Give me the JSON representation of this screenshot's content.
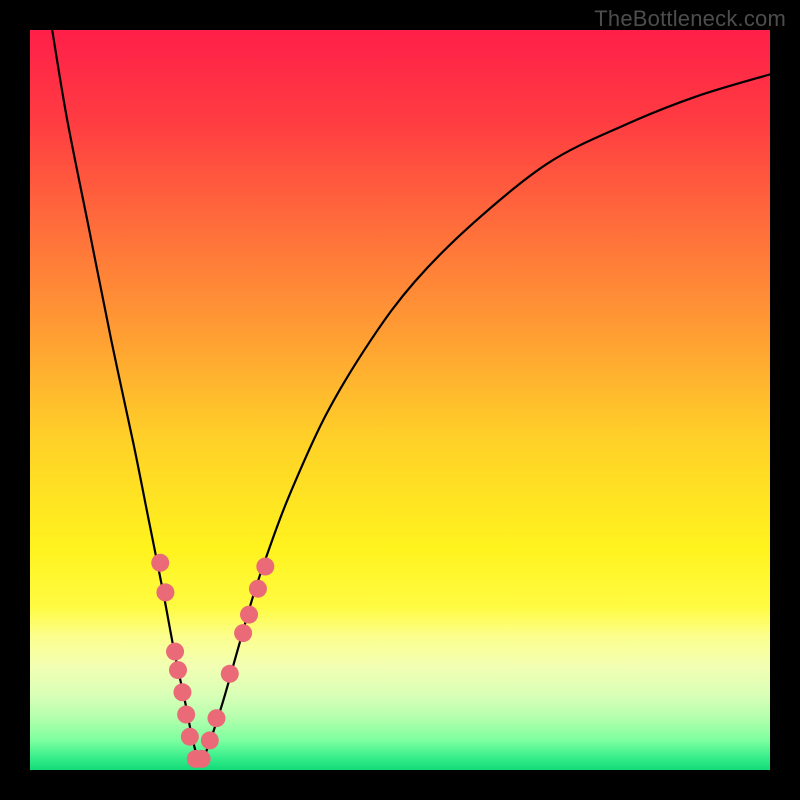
{
  "watermark": "TheBottleneck.com",
  "chart_data": {
    "type": "line",
    "title": "",
    "xlabel": "",
    "ylabel": "",
    "xlim": [
      0,
      100
    ],
    "ylim": [
      0,
      100
    ],
    "series": [
      {
        "name": "bottleneck-curve",
        "x": [
          3,
          5,
          8,
          11,
          14,
          16,
          18,
          19.5,
          21,
          22,
          23,
          24,
          26,
          28,
          30,
          32,
          35,
          40,
          46,
          52,
          60,
          70,
          80,
          90,
          100
        ],
        "y": [
          100,
          88,
          73,
          58,
          44,
          34,
          24,
          16,
          9,
          4,
          1,
          3,
          9,
          16,
          23,
          29,
          37,
          48,
          58,
          66,
          74,
          82,
          87,
          91,
          94
        ]
      }
    ],
    "markers": {
      "name": "highlight-dots",
      "color": "#ea6a78",
      "points": [
        {
          "x": 17.6,
          "y": 28.0
        },
        {
          "x": 18.3,
          "y": 24.0
        },
        {
          "x": 19.6,
          "y": 16.0
        },
        {
          "x": 20.0,
          "y": 13.5
        },
        {
          "x": 20.6,
          "y": 10.5
        },
        {
          "x": 21.1,
          "y": 7.5
        },
        {
          "x": 21.6,
          "y": 4.5
        },
        {
          "x": 22.4,
          "y": 1.5
        },
        {
          "x": 23.2,
          "y": 1.5
        },
        {
          "x": 24.3,
          "y": 4.0
        },
        {
          "x": 25.2,
          "y": 7.0
        },
        {
          "x": 27.0,
          "y": 13.0
        },
        {
          "x": 28.8,
          "y": 18.5
        },
        {
          "x": 29.6,
          "y": 21.0
        },
        {
          "x": 30.8,
          "y": 24.5
        },
        {
          "x": 31.8,
          "y": 27.5
        }
      ]
    },
    "background": {
      "type": "vertical-gradient",
      "stops": [
        {
          "pos": 0.0,
          "color": "#ff1f49"
        },
        {
          "pos": 0.12,
          "color": "#ff3b42"
        },
        {
          "pos": 0.25,
          "color": "#ff683c"
        },
        {
          "pos": 0.4,
          "color": "#ff9a34"
        },
        {
          "pos": 0.55,
          "color": "#ffd028"
        },
        {
          "pos": 0.7,
          "color": "#fff31e"
        },
        {
          "pos": 0.78,
          "color": "#fffb42"
        },
        {
          "pos": 0.82,
          "color": "#fcff8e"
        },
        {
          "pos": 0.86,
          "color": "#f2ffb3"
        },
        {
          "pos": 0.9,
          "color": "#d8ffb7"
        },
        {
          "pos": 0.93,
          "color": "#b3ffad"
        },
        {
          "pos": 0.96,
          "color": "#7dffa0"
        },
        {
          "pos": 0.985,
          "color": "#33ec89"
        },
        {
          "pos": 1.0,
          "color": "#13d977"
        }
      ]
    }
  }
}
